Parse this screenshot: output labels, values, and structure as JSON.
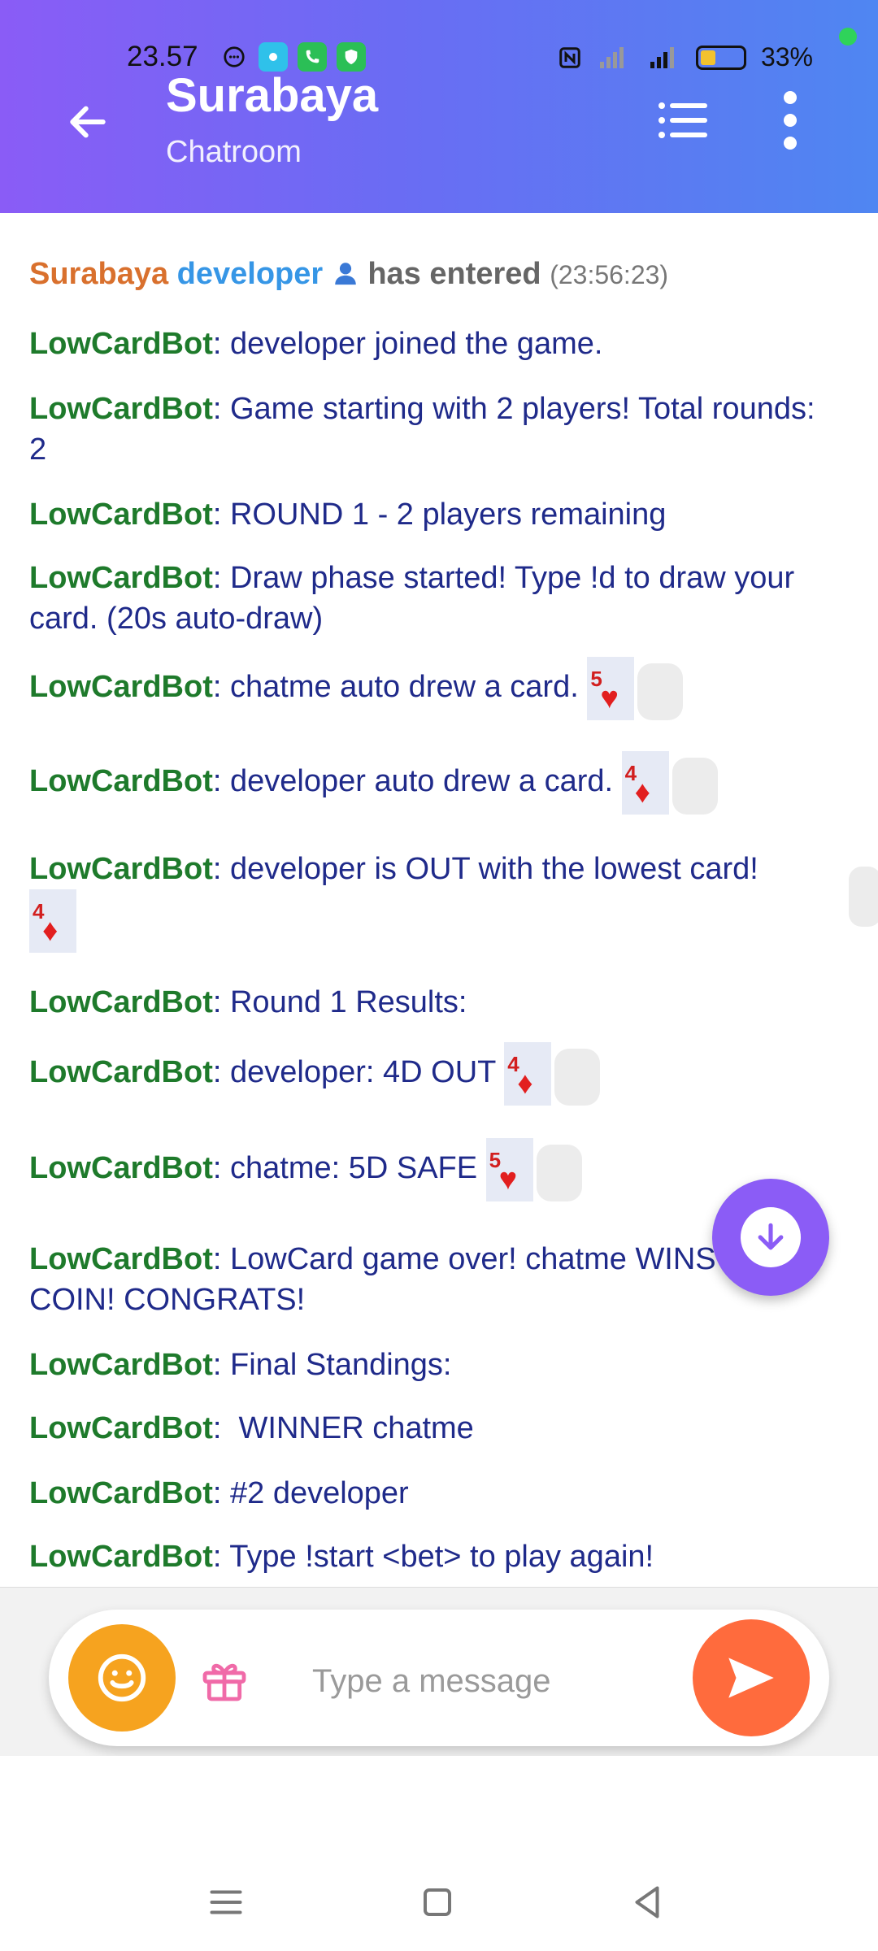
{
  "status": {
    "time": "23.57",
    "battery": "33%"
  },
  "header": {
    "title": "Surabaya",
    "subtitle": "Chatroom"
  },
  "messages": {
    "entered": {
      "room": "Surabaya",
      "user": "developer",
      "text": "has entered",
      "time": "(23:56:23)"
    },
    "bot_name": "LowCardBot",
    "m1": ": developer joined the game.",
    "m2": ": Game starting with 2 players! Total rounds: 2",
    "m3": ": ROUND 1 - 2 players remaining",
    "m4": ": Draw phase started! Type !d to draw your card. (20s auto-draw)",
    "m5": ": chatme auto drew a card.",
    "m6": ": developer auto drew a card.",
    "m7": ": developer is OUT with the lowest card!",
    "m8": ": Round 1 Results:",
    "m9": ": developer: 4D OUT",
    "m10": ": chatme: 5D SAFE",
    "m11": ": LowCard game over! chatme WINS 900.0 COIN! CONGRATS!",
    "m12": ": Final Standings:",
    "m13": ":  WINNER chatme",
    "m14": ": #2 developer",
    "m15": ": Type !start <bet> to play again!"
  },
  "cards": {
    "c5": {
      "rank": "5",
      "suit": "♥"
    },
    "c4": {
      "rank": "4",
      "suit": "♦"
    }
  },
  "composer": {
    "placeholder": "Type a message"
  }
}
